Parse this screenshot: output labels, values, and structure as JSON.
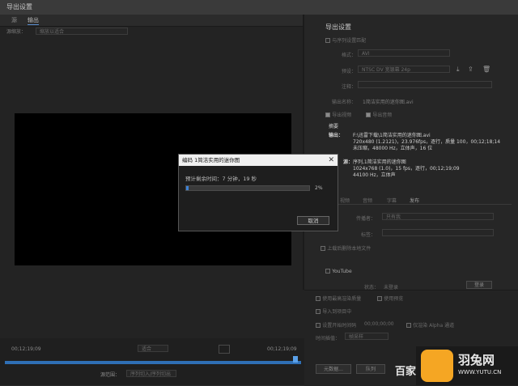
{
  "window": {
    "title": "导出设置"
  },
  "left": {
    "tabs": [
      {
        "label": "源"
      },
      {
        "label": "输出"
      }
    ],
    "source_scaling_label": "源缩放：",
    "source_scaling_value": "缩放以适合",
    "timecode_start": "00;12;19;09",
    "timecode_end": "00;12;19;09",
    "range_label": "源范围：",
    "range_value": "序列切入/序列切出",
    "fit_value": "适合"
  },
  "right": {
    "section_title": "导出设置",
    "match_seq_label": "与序列设置匹配",
    "format_label": "格式：",
    "format_value": "AVI",
    "preset_label": "预设：",
    "preset_value": "NTSC DV 宽银幕 24p",
    "comment_label": "注释：",
    "output_name_label": "输出名称：",
    "output_name_value": "1简洁实用的迷你图.avi",
    "export_video_label": "导出视频",
    "export_audio_label": "导出音频",
    "summary_title": "摘要",
    "summary_output_label": "输出：",
    "summary_output_lines": [
      "F:\\迅雷下载\\1简洁实用的迷你图.avi",
      "720x480 (1.2121)，23.976fps，逐行，质量 100，00;12;18;14",
      "未压缩，48000 Hz，立体声，16 位"
    ],
    "summary_source_label": "源：",
    "summary_source_lines": [
      "序列,1简洁实用的迷你图",
      "1024x768 (1.0)，15 fps，逐行，00;12;19;09",
      "44100 Hz，立体声"
    ],
    "tabs2": [
      {
        "label": "视频"
      },
      {
        "label": "音频"
      },
      {
        "label": "字幕"
      },
      {
        "label": "发布"
      }
    ],
    "dest_label": "传播者：",
    "dest_value": "只有我",
    "tags_label": "标签：",
    "delete_local_label": "上载后删除本地文件",
    "youtube_label": "YouTube",
    "status_label": "状态：",
    "status_value": "未登录",
    "login_label": "登录",
    "max_render_label": "使用最高渲染质量",
    "use_preview_label": "使用预览",
    "import_project_label": "导入到项目中",
    "set_start_tc_label": "设置开始时间码",
    "start_tc_value": "00;00;00;00",
    "render_alpha_label": "仅渲染 Alpha 通道",
    "interp_label": "时间插值：",
    "interp_value": "帧采样",
    "metadata_label": "元数据...",
    "queue_label": "队列",
    "export_label": "导出",
    "cancel_label": "取消"
  },
  "dialog": {
    "title": "编码 1简洁实用的迷你图",
    "remaining": "预计剩余时间：7 分钟，19 秒",
    "progress_text": "2%",
    "progress": 0.02,
    "cancel": "取消"
  },
  "watermark": {
    "baidu": "百家",
    "name": "羽兔网",
    "url": "WWW.YUTU.CN"
  }
}
